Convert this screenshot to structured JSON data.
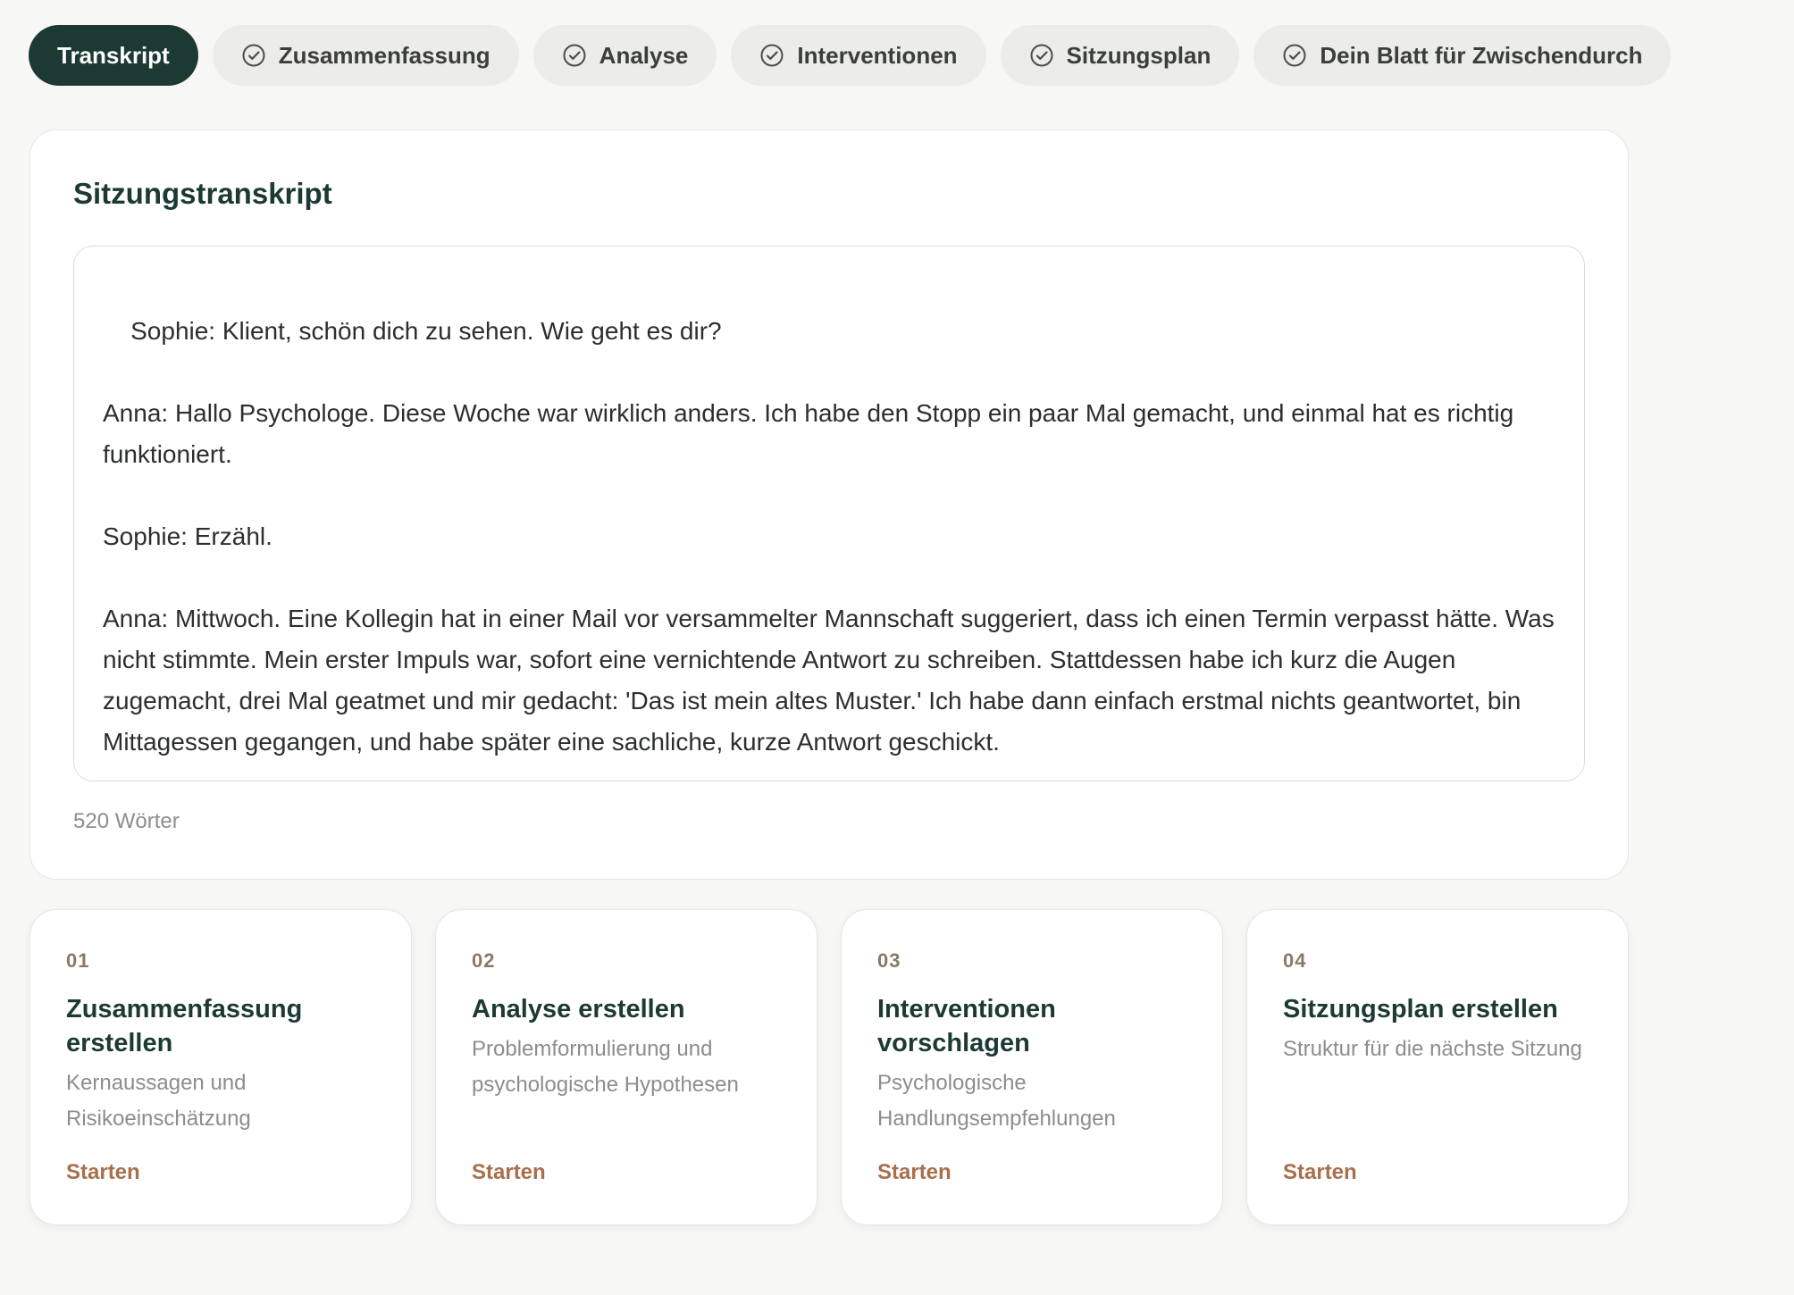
{
  "tabs": [
    {
      "label": "Transkript",
      "active": true,
      "icon": null
    },
    {
      "label": "Zusammenfassung",
      "active": false,
      "icon": "check-circle-icon"
    },
    {
      "label": "Analyse",
      "active": false,
      "icon": "check-circle-icon"
    },
    {
      "label": "Interventionen",
      "active": false,
      "icon": "check-circle-icon"
    },
    {
      "label": "Sitzungsplan",
      "active": false,
      "icon": "check-circle-icon"
    },
    {
      "label": "Dein Blatt für Zwischendurch",
      "active": false,
      "icon": "check-circle-icon"
    }
  ],
  "transcript": {
    "title": "Sitzungstranskript",
    "text": "Sophie: Klient, schön dich zu sehen. Wie geht es dir?\n\nAnna: Hallo Psychologe. Diese Woche war wirklich anders. Ich habe den Stopp ein paar Mal gemacht, und einmal hat es richtig funktioniert.\n\nSophie: Erzähl.\n\nAnna: Mittwoch. Eine Kollegin hat in einer Mail vor versammelter Mannschaft suggeriert, dass ich einen Termin verpasst hätte. Was nicht stimmte. Mein erster Impuls war, sofort eine vernichtende Antwort zu schreiben. Stattdessen habe ich kurz die Augen zugemacht, drei Mal geatmet und mir gedacht: 'Das ist mein altes Muster.' Ich habe dann einfach erstmal nichts geantwortet, bin Mittagessen gegangen, und habe später eine sachliche, kurze Antwort geschickt.",
    "word_count": "520 Wörter"
  },
  "steps": [
    {
      "number": "01",
      "title": "Zusammenfassung erstellen",
      "description": "Kernaussagen und Risikoeinschätzung",
      "action": "Starten"
    },
    {
      "number": "02",
      "title": "Analyse erstellen",
      "description": "Problemformulierung und psychologische Hypothesen",
      "action": "Starten"
    },
    {
      "number": "03",
      "title": "Interventionen vorschlagen",
      "description": "Psychologische Handlungsempfehlungen",
      "action": "Starten"
    },
    {
      "number": "04",
      "title": "Sitzungsplan erstellen",
      "description": "Struktur für die nächste Sitzung",
      "action": "Starten"
    }
  ],
  "colors": {
    "accent_dark_green": "#1c3a33",
    "action_brown": "#a86f4c",
    "background": "#f7f7f5"
  }
}
